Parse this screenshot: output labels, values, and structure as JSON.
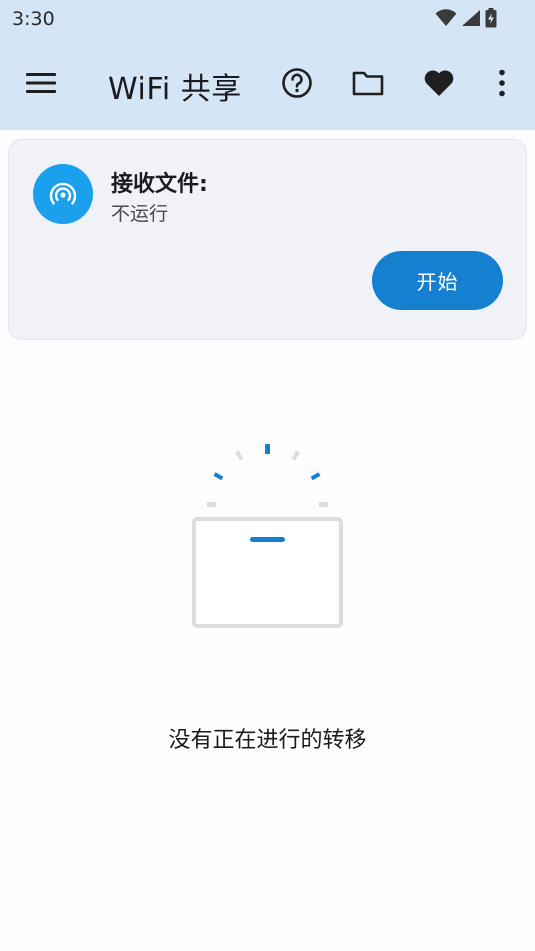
{
  "status_bar": {
    "time": "3:30",
    "icons": [
      "wifi-icon",
      "signal-icon",
      "battery-charging-icon"
    ]
  },
  "app_bar": {
    "title": "WiFi 共享",
    "icons": [
      "menu-icon",
      "help-icon",
      "folder-icon",
      "heart-icon",
      "more-vert-icon"
    ]
  },
  "receive_card": {
    "title": "接收文件:",
    "status": "不运行",
    "start_label": "开始",
    "icon": "wireless-broadcast-icon",
    "accent": "#1aa0ec",
    "button_color": "#1680d0"
  },
  "empty_state": {
    "message": "没有正在进行的转移",
    "icon": "empty-transfer-box-icon"
  },
  "colors": {
    "top_bar": "#d4e6f6",
    "background": "#fdfcff",
    "card": "#f0f2f8"
  }
}
